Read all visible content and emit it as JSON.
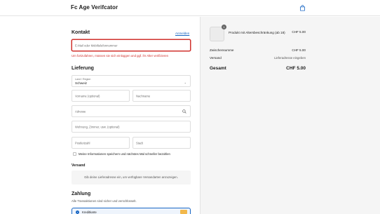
{
  "header": {
    "brand": "Fc Age Verifcator",
    "cart_icon": "shopping-bag-icon"
  },
  "contact": {
    "title": "Kontakt",
    "login_link": "Anmelden",
    "email_placeholder": "E-Mail oder Mobiltelefonnummer",
    "error_message": "Um fortzufahren, müssen sie sich einloggen und ggf. ihr Alter verifizieren"
  },
  "delivery": {
    "title": "Lieferung",
    "country_label": "Land / Region",
    "country_value": "Schweiz",
    "first_name_placeholder": "Vorname (optional)",
    "last_name_placeholder": "Nachname",
    "address_placeholder": "Adresse",
    "apartment_placeholder": "Wohnung, Zimmer, usw. (optional)",
    "postal_placeholder": "Postleitzahl",
    "city_placeholder": "Stadt",
    "save_info_label": "Meine Informationen speichern und nächstes Mal schneller bezahlen"
  },
  "shipping": {
    "title": "Versand",
    "info": "Gib deine Lieferadresse ein, um verfügbare Versandarten anzuzeigen."
  },
  "payment": {
    "title": "Zahlung",
    "subtitle": "Alle Transaktionen sind sicher und verschlüsselt.",
    "option_label": "Kreditkarte"
  },
  "summary": {
    "product_name": "Produkt mit Altersbeschränkung (ab 18)",
    "product_price": "CHF 5.00",
    "quantity": "1",
    "subtotal_label": "Zwischensumme",
    "subtotal_value": "CHF 5.00",
    "shipping_label": "Versand",
    "shipping_value": "Lieferadresse eingeben",
    "total_label": "Gesamt",
    "total_value": "CHF 5.00"
  },
  "colors": {
    "accent": "#1866c4",
    "error": "#d0312d"
  }
}
